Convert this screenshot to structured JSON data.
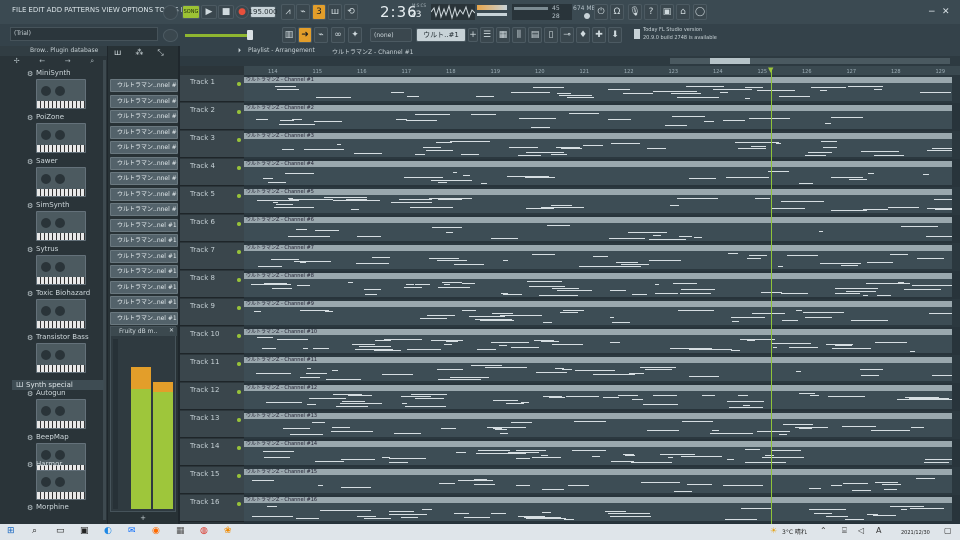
{
  "menu": [
    "FILE",
    "EDIT",
    "ADD",
    "PATTERNS",
    "VIEW",
    "OPTIONS",
    "TOOLS",
    "HELP"
  ],
  "transport": {
    "song_label": "SONG",
    "tempo": "195.000",
    "time": "2:36",
    "time_sub": "23",
    "time_unit": "M:S:CS",
    "cpu": "45",
    "mem": "674 MB",
    "poly": "28"
  },
  "hint": {
    "trial": "(Trial)",
    "pattern_none": "(none)",
    "pattern_name": "ウルト..#1",
    "news_title": "Today  FL Studio version",
    "news_body": "20.9.0 build 2748 is available"
  },
  "browser": {
    "title": "Brow.. Plugin database",
    "plugins": [
      {
        "name": "MiniSynth"
      },
      {
        "name": "PoiZone"
      },
      {
        "name": "Sawer"
      },
      {
        "name": "SimSynth"
      },
      {
        "name": "Sytrus"
      },
      {
        "name": "Toxic Biohazard"
      },
      {
        "name": "Transistor Bass"
      },
      {
        "name": "Synth special"
      },
      {
        "name": "Autogun"
      },
      {
        "name": "BeepMap"
      },
      {
        "name": "Harmor"
      },
      {
        "name": "Morphine"
      }
    ]
  },
  "channels": [
    "ウルトラマン..nnel #1",
    "ウルトラマン..nnel #2",
    "ウルトラマン..nnel #3",
    "ウルトラマン..nnel #4",
    "ウルトラマン..nnel #5",
    "ウルトラマン..nnel #6",
    "ウルトラマン..nnel #7",
    "ウルトラマン..nnel #8",
    "ウルトラマン..nnel #9",
    "ウルトラマン..nel #10",
    "ウルトラマン..nel #11",
    "ウルトラマン..nel #12",
    "ウルトラマン..nel #13",
    "ウルトラマン..nel #14",
    "ウルトラマン..nel #15",
    "ウルトラマン..nel #16"
  ],
  "mixer": {
    "title": "Fruity dB m.."
  },
  "playlist": {
    "crumb": "Playlist - Arrangement",
    "crumb2": "ウルトラマンZ - Channel #1",
    "ruler": [
      "114",
      "115",
      "116",
      "117",
      "118",
      "119",
      "120",
      "121",
      "122",
      "123",
      "124",
      "125",
      "126",
      "127",
      "128",
      "129"
    ],
    "tracks": [
      "Track 1",
      "Track 2",
      "Track 3",
      "Track 4",
      "Track 5",
      "Track 6",
      "Track 7",
      "Track 8",
      "Track 9",
      "Track 10",
      "Track 11",
      "Track 12",
      "Track 13",
      "Track 14",
      "Track 15",
      "Track 16"
    ],
    "clips": [
      "ウルトラマンZ - Channel #1",
      "ウルトラマンZ - Channel #2",
      "ウルトラマンZ - Channel #3",
      "ウルトラマンZ - Channel #4",
      "ウルトラマンZ - Channel #5",
      "ウルトラマンZ - Channel #6",
      "ウルトラマンZ - Channel #7",
      "ウルトラマンZ - Channel #8",
      "ウルトラマンZ - Channel #9",
      "ウルトラマンZ - Channel #10",
      "ウルトラマンZ - Channel #11",
      "ウルトラマンZ - Channel #12",
      "ウルトラマンZ - Channel #13",
      "ウルトラマンZ - Channel #14",
      "ウルトラマンZ - Channel #15",
      "ウルトラマンZ - Channel #16"
    ]
  },
  "taskbar": {
    "temp": "3°C 晴れ",
    "date": "2021/12/30",
    "ime": "A"
  }
}
